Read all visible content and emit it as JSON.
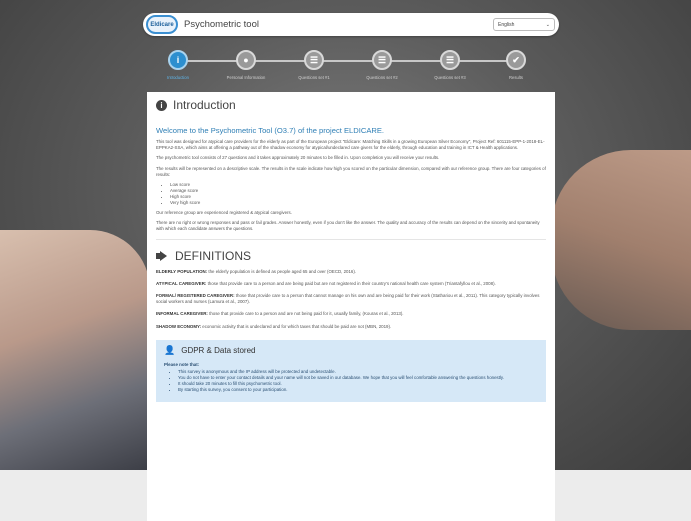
{
  "header": {
    "logo_text": "Eldicare",
    "title": "Psychometric tool",
    "language": "English"
  },
  "steps": [
    {
      "label": "Introduction",
      "icon": "i",
      "active": true
    },
    {
      "label": "Personal Information",
      "icon": "●",
      "active": false
    },
    {
      "label": "Questions set #1",
      "icon": "☰",
      "active": false
    },
    {
      "label": "Questions set #2",
      "icon": "☰",
      "active": false
    },
    {
      "label": "Questions set #3",
      "icon": "☰",
      "active": false
    },
    {
      "label": "Results",
      "icon": "✔",
      "active": false
    }
  ],
  "intro": {
    "heading": "Introduction",
    "welcome": "Welcome to the Psychometric Tool (O3.7) of the project ELDICARE.",
    "p1": "This tool was designed for atypical care providers for the elderly as part of the European project \"Eldicare: Matching Skills in a growing European Silver Economy\", Project Ref: 601115-EPP-1-2018-EL-EPPKA2-SSA, which aims at offering a pathway out of the shadow economy for atypical/undeclared care givers for the elderly, through education and training in ICT & Health applications.",
    "p2": "The psychometric tool consists of 27 questions and it takes approximately 20 minutes to be filled in. Upon completion you will receive your results.",
    "p3": "The results will be represented on a descriptive scale. The results in the scale indicate how high you scored on the particular dimension, compared with our reference group. There are four categories of results:",
    "categories": [
      "Low score",
      "Average score",
      "High score",
      "Very high score"
    ],
    "p4": "Our reference group are experienced registered & atypical caregivers.",
    "p5": "There are no right or wrong responses and pass or fail grades. Answer honestly, even if you don't like the answer. The quality and accuracy of the results can depend on the sincerity and spontaneity with which each candidate answers the questions."
  },
  "definitions": {
    "heading": "DEFINITIONS",
    "items": [
      {
        "term": "ELDERLY POPULATION:",
        "text": " the elderly population is defined as people aged 65 and over (OECD, 2016)."
      },
      {
        "term": "ATYPICAL CAREGIVER:",
        "text": " those that provide care to a person and are being paid but are not registered in their country's national health care system (Triantafyllou et al., 2008)."
      },
      {
        "term": "FORMAL/ REGISTERED CAREGIVER:",
        "text": " those that provide care to a person that cannot manage on his own and are being paid for their work (Stathariou et al., 2011). This category typically involves social workers and nurses (Lamura et al., 2007)."
      },
      {
        "term": "INFORMAL CAREGIVER:",
        "text": " those that provide care to a person and are not being paid for it, usually family, (Kouras et al., 2013)."
      },
      {
        "term": "SHADOW ECONOMY:",
        "text": " economic activity that is undeclared and for which taxes that should be paid are not (MBN, 2019)."
      }
    ]
  },
  "gdpr": {
    "heading": "GDPR & Data stored",
    "note": "Please note that:",
    "items": [
      "This survey is anonymous and the IP address will be protected and undetectable.",
      "You do not have to enter your contact details and your name will not be saved in our database. We hope that you will feel comfortable answering the questions honestly.",
      "It should take 20 minutes to fill this psychometric tool.",
      "By starting this survey, you consent to your participation."
    ]
  }
}
